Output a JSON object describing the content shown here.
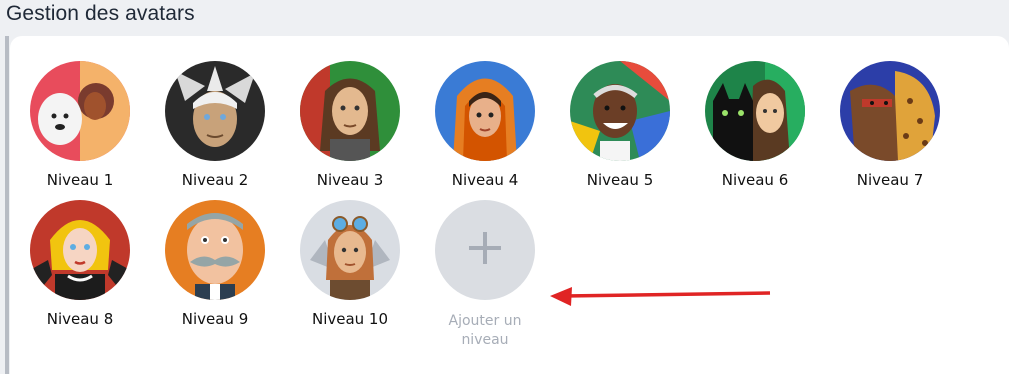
{
  "header": {
    "title": "Gestion des avatars"
  },
  "avatars": [
    {
      "label": "Niveau 1",
      "icon": "avatar-portrait-woman-with-dog",
      "colors": [
        "#e84c5c",
        "#f4b26a",
        "#7a3b2e"
      ]
    },
    {
      "label": "Niveau 2",
      "icon": "avatar-portrait-white-haired-man",
      "colors": [
        "#2a2a2a",
        "#d9d9d9",
        "#c8a27a"
      ]
    },
    {
      "label": "Niveau 3",
      "icon": "avatar-portrait-long-haired-man",
      "colors": [
        "#2f8f3a",
        "#c0392b",
        "#e3b98f"
      ]
    },
    {
      "label": "Niveau 4",
      "icon": "avatar-portrait-girl-in-hood",
      "colors": [
        "#3a7bd5",
        "#e67e22",
        "#d35400"
      ]
    },
    {
      "label": "Niveau 5",
      "icon": "avatar-portrait-smiling-man",
      "colors": [
        "#2e8b57",
        "#e74c3c",
        "#6b3e26"
      ]
    },
    {
      "label": "Niveau 6",
      "icon": "avatar-portrait-woman-with-black-cat",
      "colors": [
        "#1e8449",
        "#111111",
        "#f0c9a0"
      ]
    },
    {
      "label": "Niveau 7",
      "icon": "avatar-portrait-man-with-cheetah",
      "colors": [
        "#2c3ea8",
        "#e0a33a",
        "#7a4a2a"
      ]
    },
    {
      "label": "Niveau 8",
      "icon": "avatar-portrait-blonde-woman",
      "colors": [
        "#c0392b",
        "#f1c40f",
        "#f6d5c3"
      ]
    },
    {
      "label": "Niveau 9",
      "icon": "avatar-portrait-man-with-mustache",
      "colors": [
        "#e67e22",
        "#95a5a6",
        "#f2c2a0"
      ]
    },
    {
      "label": "Niveau 10",
      "icon": "avatar-portrait-aviator-woman",
      "colors": [
        "#d9dde3",
        "#c0703a",
        "#e8b98f"
      ]
    }
  ],
  "add_level": {
    "label": "Ajouter un niveau",
    "icon": "plus-icon",
    "color": "#dadde2"
  },
  "arrow": {
    "icon": "arrow-left-icon",
    "color": "#e02424"
  }
}
